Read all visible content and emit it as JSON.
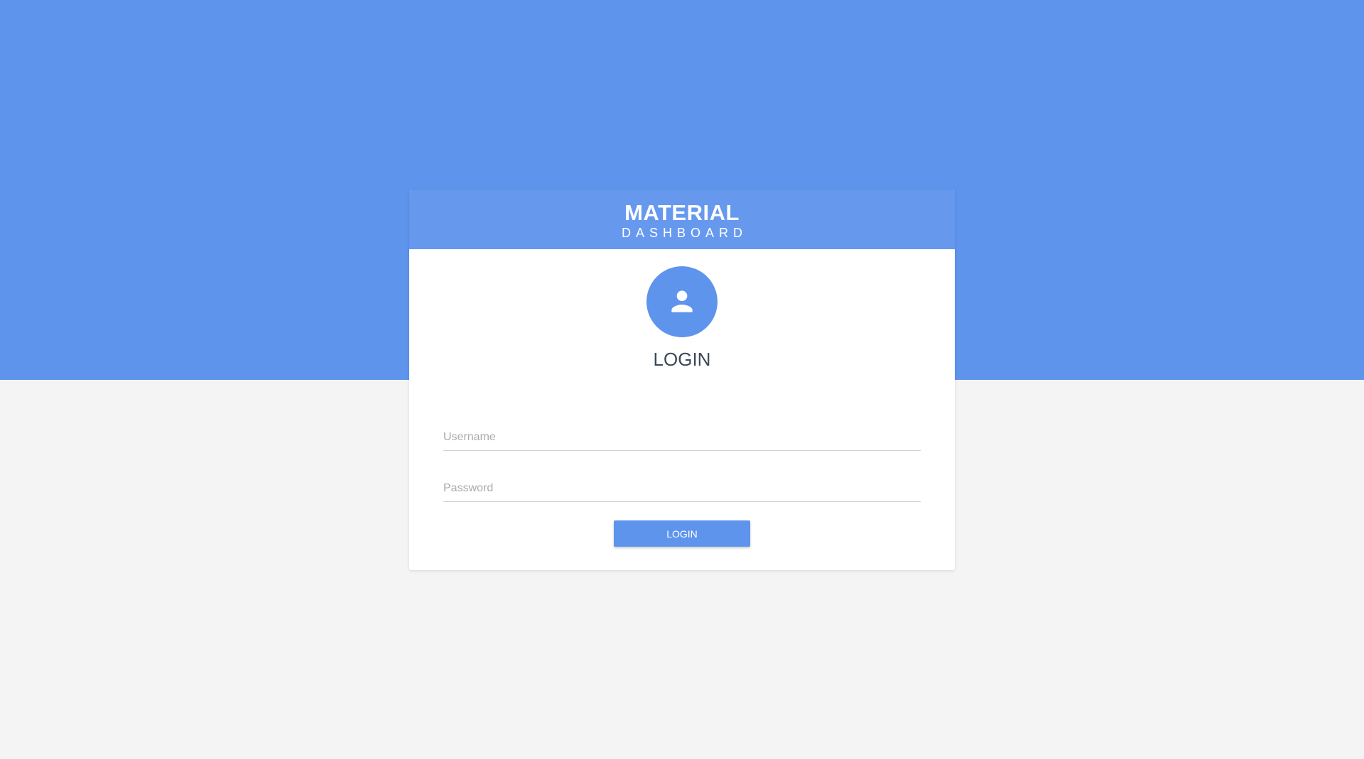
{
  "brand": {
    "title": "MATERIAL",
    "subtitle": "DASHBOARD"
  },
  "avatar_icon": "user-icon",
  "form": {
    "heading": "LOGIN",
    "username_placeholder": "Username",
    "username_value": "",
    "password_placeholder": "Password",
    "password_value": "",
    "submit_label": "LOGIN"
  },
  "colors": {
    "accent": "#5e94ec",
    "header": "#6699ee",
    "background": "#f4f4f4",
    "card": "#ffffff",
    "heading_text": "#3c4858"
  }
}
